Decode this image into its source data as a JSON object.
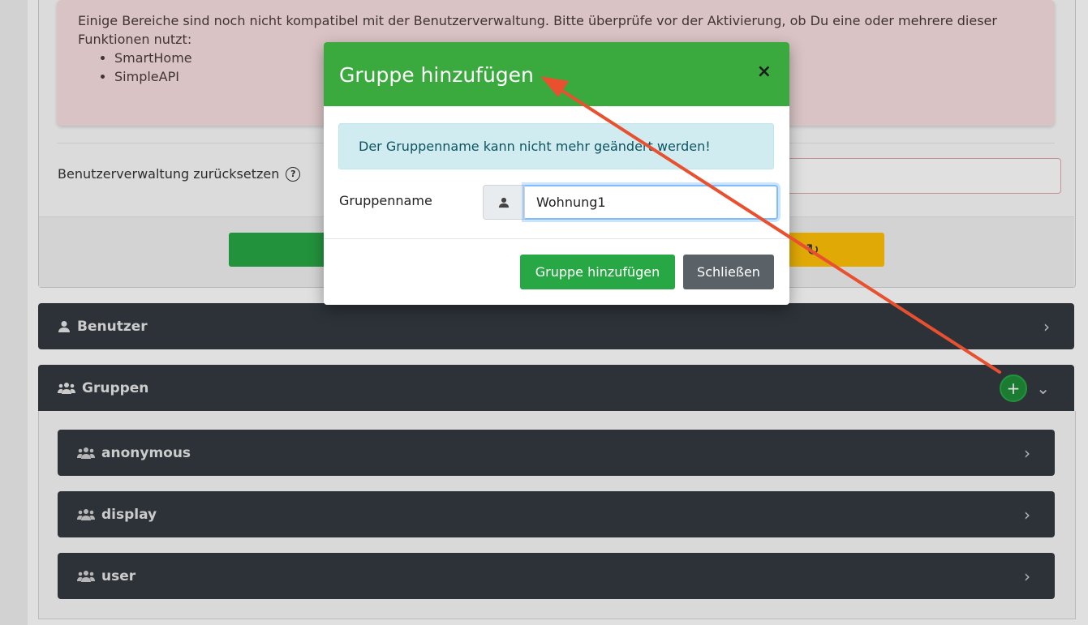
{
  "warning": {
    "text": "Einige Bereiche sind noch nicht kompatibel mit der Benutzerverwaltung. Bitte überprüfe vor der Aktivierung, ob Du eine oder mehrere dieser Funktionen nutzt:",
    "items": [
      "SmartHome",
      "SimpleAPI"
    ]
  },
  "reset": {
    "label": "Benutzerverwaltung zurücksetzen",
    "help_icon": "question-circle-icon"
  },
  "panels": {
    "benutzer": {
      "label": "Benutzer",
      "icon": "user-icon"
    },
    "gruppen": {
      "label": "Gruppen",
      "icon": "users-icon",
      "add_label": "+"
    },
    "groups": [
      {
        "label": "anonymous"
      },
      {
        "label": "display"
      },
      {
        "label": "user"
      }
    ]
  },
  "modal": {
    "title": "Gruppe hinzufügen",
    "close_label": "×",
    "info": "Der Gruppenname kann nicht mehr geändert werden!",
    "field_label": "Gruppenname",
    "field_value": "Wohnung1",
    "add_button": "Gruppe hinzufügen",
    "close_button": "Schließen"
  },
  "colors": {
    "header_green": "#3aaa3e",
    "panel_dark": "#343a40",
    "arrow_red": "#e8502f",
    "info_bg": "#d1ecf1"
  }
}
